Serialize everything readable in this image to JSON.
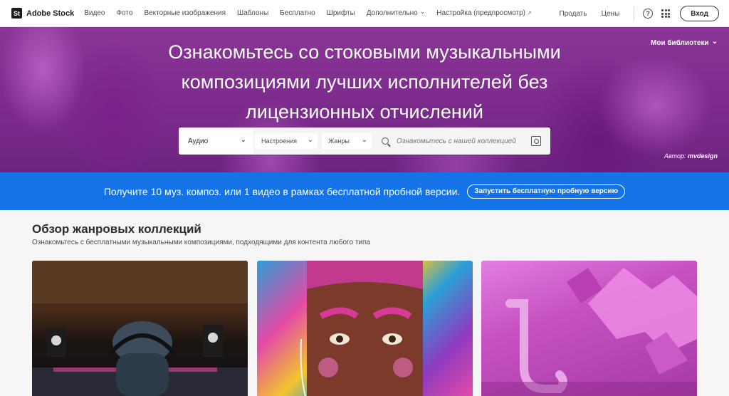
{
  "nav": {
    "brand_mark": "St",
    "brand": "Adobe Stock",
    "links": [
      "Видео",
      "Фото",
      "Векторные изображения",
      "Шаблоны",
      "Бесплатно",
      "Шрифты",
      "Дополнительно",
      "Настройка (предпросмотр)"
    ],
    "external_glyph": "↗",
    "sell": "Продать",
    "pricing": "Цены",
    "help_glyph": "?",
    "sign_in": "Вход"
  },
  "hero": {
    "title": "Ознакомьтесь со стоковыми музыкальными композициями лучших исполнителей без лицензионных отчислений",
    "my_libraries": "Мои библиотеки",
    "credit_prefix": "Автор:",
    "credit_name": "mvdesign"
  },
  "search": {
    "type": "Аудио",
    "mood": "Настроения",
    "genre": "Жанры",
    "placeholder": "Ознакомьтесь с нашей коллекцией"
  },
  "promo": {
    "text": "Получите 10 муз. композ. или 1 видео в рамках бесплатной пробной версии.",
    "button": "Запустить бесплатную пробную версию",
    "color": "#1473e6"
  },
  "collections": {
    "title": "Обзор жанровых коллекций",
    "subtitle": "Ознакомьтесь с бесплатными музыкальными композициями, подходящими для контента любого типа"
  },
  "colors": {
    "hero_purple": "#7d2c8d",
    "accent_blue": "#1473e6"
  }
}
